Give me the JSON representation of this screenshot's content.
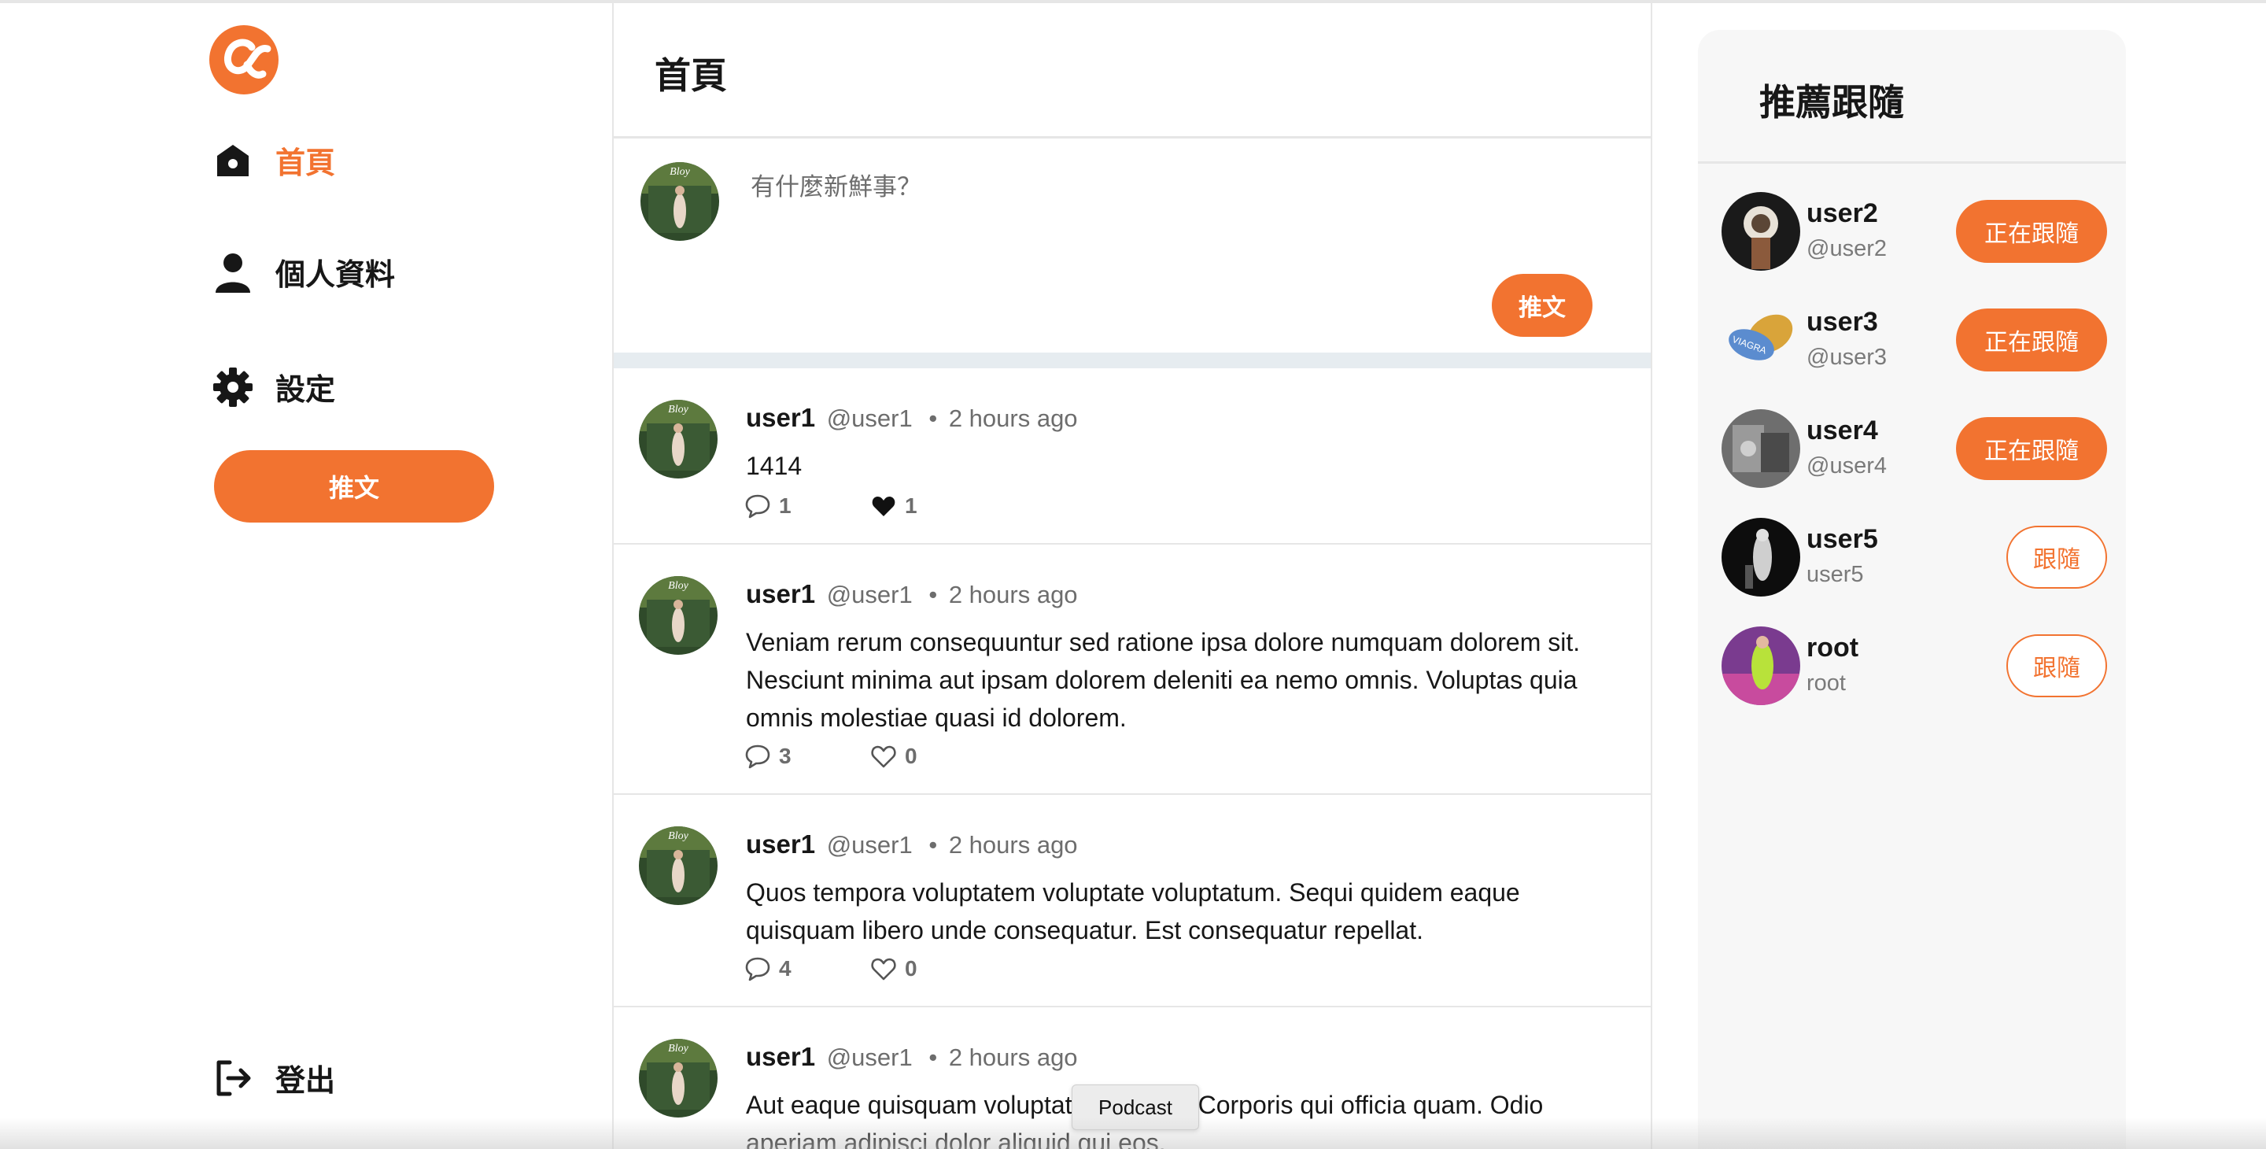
{
  "brand": {
    "accent": "#f27330",
    "divider": "#e6e6e6",
    "text": "#171717",
    "muted": "#6d6d6d"
  },
  "sidebar": {
    "logo_icon": "alpha-logo-icon",
    "items": [
      {
        "label": "首頁",
        "icon": "home-icon",
        "active": true
      },
      {
        "label": "個人資料",
        "icon": "user-icon",
        "active": false
      },
      {
        "label": "設定",
        "icon": "gear-icon",
        "active": false
      }
    ],
    "tweet_button": "推文",
    "logout": {
      "label": "登出",
      "icon": "logout-icon"
    }
  },
  "main": {
    "title": "首頁",
    "compose": {
      "placeholder": "有什麼新鮮事？",
      "button": "推文"
    },
    "tweets": [
      {
        "name": "user1",
        "handle": "@user1",
        "dot": "•",
        "time": "2 hours ago",
        "text": "1414",
        "replies": "1",
        "likes": "1",
        "liked": true
      },
      {
        "name": "user1",
        "handle": "@user1",
        "dot": "•",
        "time": "2 hours ago",
        "text": "Veniam rerum consequuntur sed ratione ipsa dolore numquam dolorem sit. Nesciunt minima aut ipsam dolorem deleniti ea nemo omnis. Voluptas quia omnis molestiae quasi id dolorem.",
        "replies": "3",
        "likes": "0",
        "liked": false
      },
      {
        "name": "user1",
        "handle": "@user1",
        "dot": "•",
        "time": "2 hours ago",
        "text": "Quos tempora voluptatem voluptate voluptatum. Sequi quidem eaque quisquam libero unde consequatur. Est consequatur repellat.",
        "replies": "4",
        "likes": "0",
        "liked": false
      },
      {
        "name": "user1",
        "handle": "@user1",
        "dot": "•",
        "time": "2 hours ago",
        "text": "Aut eaque quisquam voluptatem quatur. Corporis qui officia quam. Odio aperiam adipisci dolor aliquid qui eos."
      }
    ]
  },
  "recommend": {
    "title": "推薦跟隨",
    "users": [
      {
        "name": "user2",
        "handle": "@user2",
        "button": "正在跟隨",
        "following": true
      },
      {
        "name": "user3",
        "handle": "@user3",
        "button": "正在跟隨",
        "following": true
      },
      {
        "name": "user4",
        "handle": "@user4",
        "button": "正在跟隨",
        "following": true
      },
      {
        "name": "user5",
        "handle": "user5",
        "button": "跟隨",
        "following": false
      },
      {
        "name": "root",
        "handle": "root",
        "button": "跟隨",
        "following": false
      }
    ]
  },
  "tooltip": "Podcast"
}
